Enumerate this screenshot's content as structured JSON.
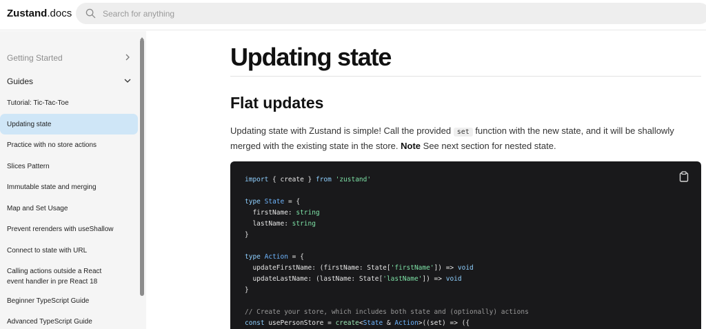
{
  "header": {
    "logo_bold": "Zustand",
    "logo_light": ".docs",
    "search_placeholder": "Search for anything"
  },
  "sidebar": {
    "sections": [
      {
        "label": "Getting Started",
        "expanded": false
      },
      {
        "label": "Guides",
        "expanded": true
      }
    ],
    "items": [
      {
        "label": "Tutorial: Tic-Tac-Toe",
        "active": false
      },
      {
        "label": "Updating state",
        "active": true
      },
      {
        "label": "Practice with no store actions",
        "active": false
      },
      {
        "label": "Slices Pattern",
        "active": false
      },
      {
        "label": "Immutable state and merging",
        "active": false
      },
      {
        "label": "Map and Set Usage",
        "active": false
      },
      {
        "label": "Prevent rerenders with useShallow",
        "active": false
      },
      {
        "label": "Connect to state with URL",
        "active": false
      },
      {
        "label": "Calling actions outside a React event handler in pre React 18",
        "active": false
      },
      {
        "label": "Beginner TypeScript Guide",
        "active": false
      },
      {
        "label": "Advanced TypeScript Guide",
        "active": false
      }
    ]
  },
  "main": {
    "title": "Updating state",
    "section_heading": "Flat updates",
    "paragraph": {
      "part1": "Updating state with Zustand is simple! Call the provided ",
      "code": "set",
      "part2": " function with the new state, and it will be shallowly merged with the existing state in the store. ",
      "bold": "Note",
      "part3": " See next section for nested state."
    },
    "code_lines": [
      [
        {
          "t": "import",
          "c": "kw"
        },
        {
          "t": " { create } "
        },
        {
          "t": "from",
          "c": "kw"
        },
        {
          "t": " "
        },
        {
          "t": "'zustand'",
          "c": "str"
        }
      ],
      [],
      [
        {
          "t": "type",
          "c": "kw"
        },
        {
          "t": " "
        },
        {
          "t": "State",
          "c": "ty"
        },
        {
          "t": " = {"
        }
      ],
      [
        {
          "t": "  firstName: "
        },
        {
          "t": "string",
          "c": "str"
        }
      ],
      [
        {
          "t": "  lastName: "
        },
        {
          "t": "string",
          "c": "str"
        }
      ],
      [
        {
          "t": "}"
        }
      ],
      [],
      [
        {
          "t": "type",
          "c": "kw"
        },
        {
          "t": " "
        },
        {
          "t": "Action",
          "c": "ty"
        },
        {
          "t": " = {"
        }
      ],
      [
        {
          "t": "  updateFirstName: (firstName: State["
        },
        {
          "t": "'firstName'",
          "c": "str"
        },
        {
          "t": "]) => "
        },
        {
          "t": "void",
          "c": "kw"
        }
      ],
      [
        {
          "t": "  updateLastName: (lastName: State["
        },
        {
          "t": "'lastName'",
          "c": "str"
        },
        {
          "t": "]) => "
        },
        {
          "t": "void",
          "c": "kw"
        }
      ],
      [
        {
          "t": "}"
        }
      ],
      [],
      [
        {
          "t": "// Create your store, which includes both state and (optionally) actions",
          "c": "cm"
        }
      ],
      [
        {
          "t": "const",
          "c": "kw"
        },
        {
          "t": " usePersonStore = "
        },
        {
          "t": "create",
          "c": "fn"
        },
        {
          "t": "<"
        },
        {
          "t": "State",
          "c": "ty"
        },
        {
          "t": " & "
        },
        {
          "t": "Action",
          "c": "ty"
        },
        {
          "t": ">((set) => ({"
        }
      ]
    ]
  }
}
